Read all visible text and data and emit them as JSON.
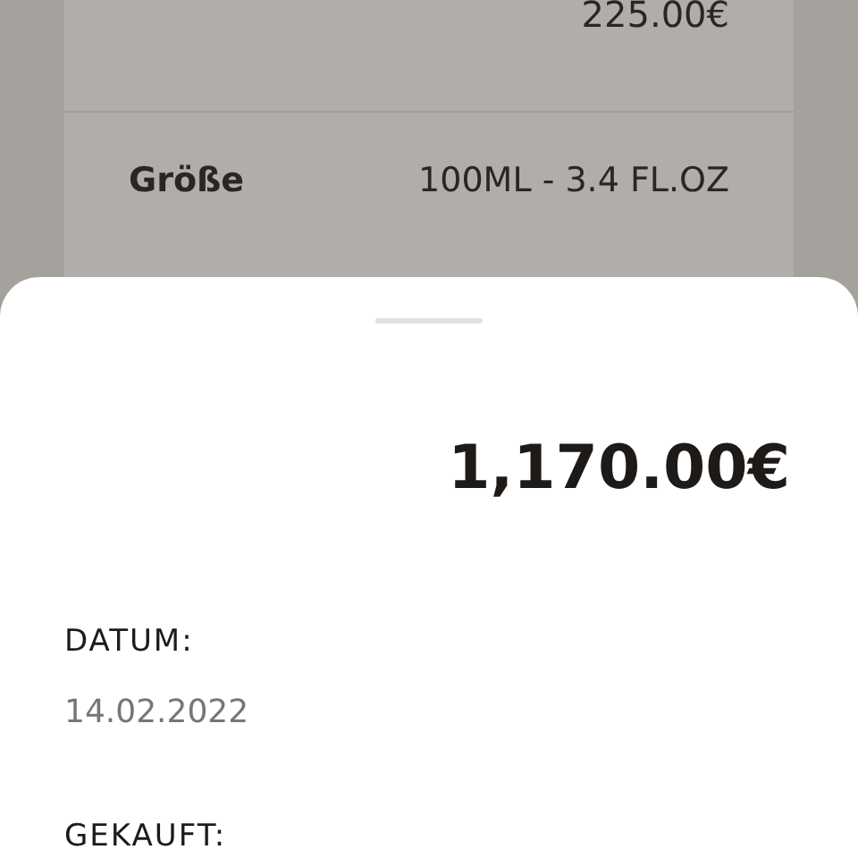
{
  "background_card": {
    "price": "225.00€",
    "size_label": "Größe",
    "size_value": "100ML - 3.4 FL.OZ"
  },
  "sheet": {
    "total": "1,170.00€",
    "fields": [
      {
        "label": "DATUM:",
        "value": "14.02.2022"
      },
      {
        "label": "GEKAUFT:"
      }
    ]
  }
}
